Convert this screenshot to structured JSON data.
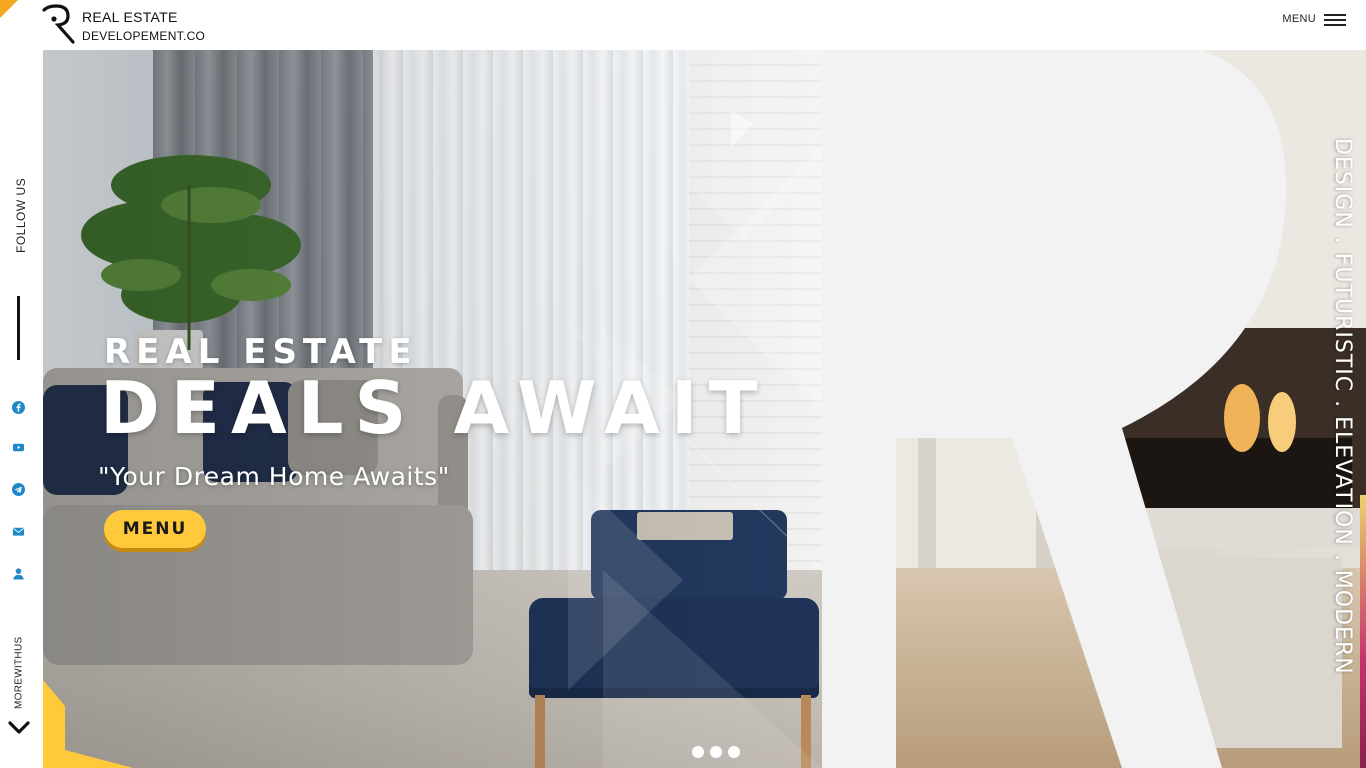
{
  "header": {
    "brand_line1": "REAL ESTATE",
    "brand_line2": "DEVELOPEMENT.CO",
    "menu_label": "MENU"
  },
  "sidebar": {
    "follow_label": "FOLLOW US",
    "social_icons": [
      "facebook-icon",
      "youtube-icon",
      "telegram-icon",
      "mail-icon",
      "user-icon"
    ],
    "more_label": "MOREWITHUS"
  },
  "hero": {
    "kicker": "REAL ESTATE",
    "headline": "DEALS AWAIT",
    "tagline": "\"Your Dream Home Awaits\"",
    "menu_button": "MENU",
    "slide_count": 3
  },
  "right_panel": {
    "slogan": "DESIGN . FUTURISTIC . ELEVATION . MODERN"
  },
  "colors": {
    "accent_yellow": "#ffc93c",
    "orange_corner": "#f5a623",
    "social_blue": "#1e88c8",
    "letter_gray": "#f2f2f2"
  }
}
